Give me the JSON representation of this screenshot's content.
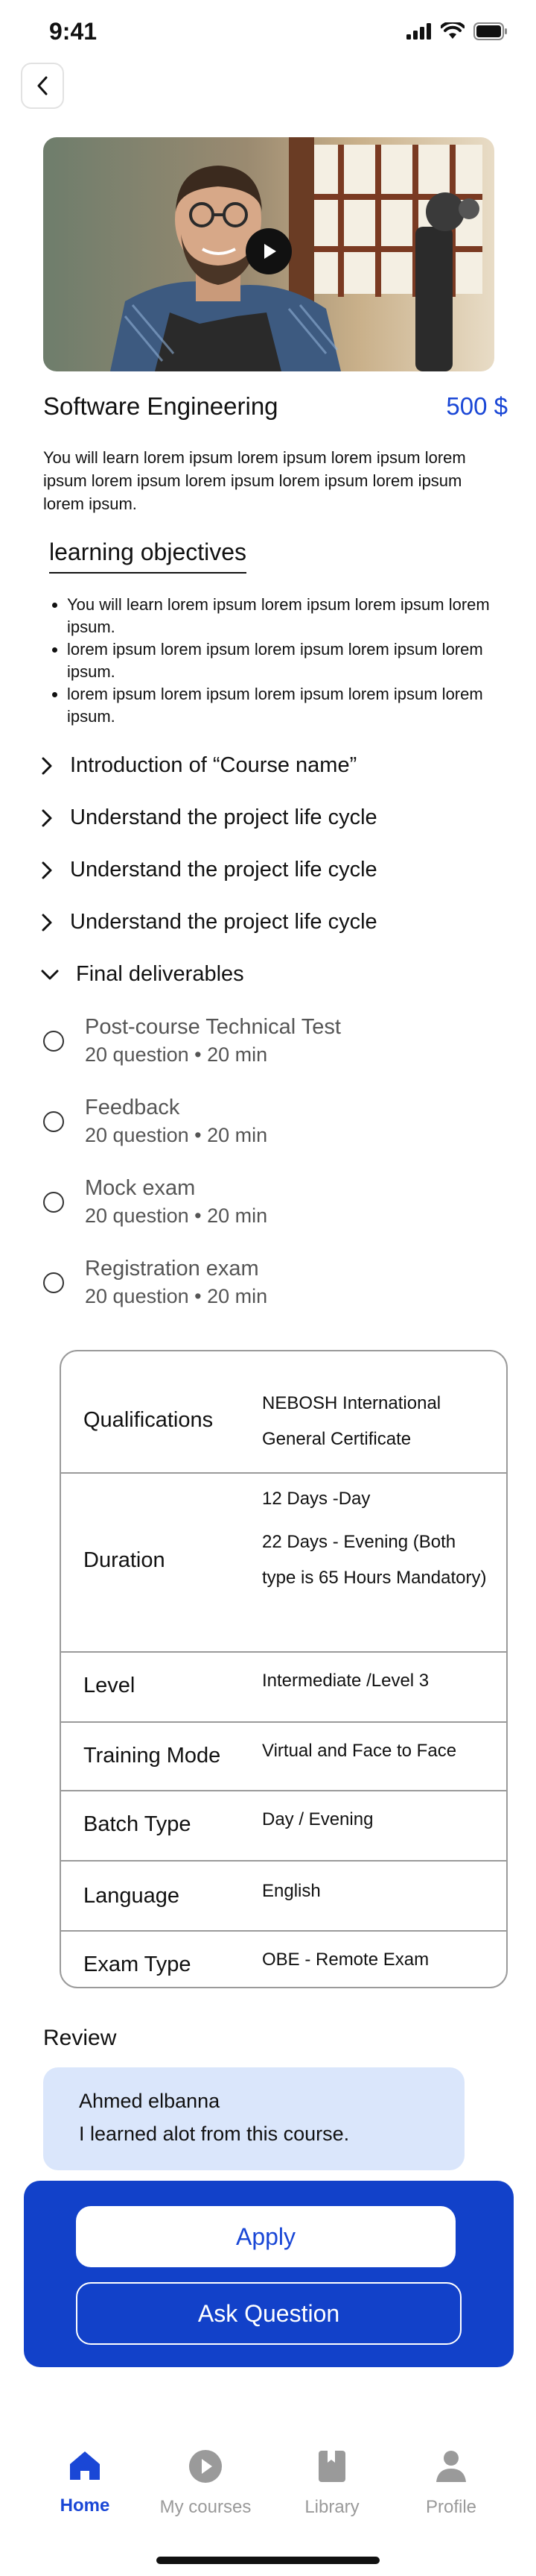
{
  "status": {
    "time": "9:41"
  },
  "course": {
    "title": "Software Engineering",
    "price": "500 $",
    "description": "You will learn lorem ipsum lorem ipsum lorem ipsum lorem ipsum lorem ipsum lorem ipsum lorem ipsum lorem ipsum lorem ipsum."
  },
  "objectives": {
    "title": "learning objectives",
    "items": [
      "You will learn lorem ipsum lorem ipsum lorem ipsum lorem ipsum.",
      "lorem ipsum lorem ipsum lorem ipsum lorem ipsum lorem ipsum.",
      "lorem ipsum lorem ipsum lorem ipsum lorem ipsum lorem ipsum."
    ]
  },
  "modules": [
    "Introduction of “Course name”",
    "Understand the project life cycle",
    "Understand the project life cycle",
    "Understand the project life cycle"
  ],
  "final": {
    "label": "Final deliverables",
    "items": [
      {
        "title": "Post-course Technical Test",
        "meta": "20 question • 20 min"
      },
      {
        "title": "Feedback",
        "meta": "20 question • 20 min"
      },
      {
        "title": "Mock exam",
        "meta": "20 question • 20 min"
      },
      {
        "title": "Registration exam",
        "meta": "20 question • 20 min"
      }
    ]
  },
  "info": {
    "qualifications": {
      "label": "Qualifications",
      "value": "NEBOSH International General Certificate"
    },
    "duration": {
      "label": "Duration",
      "value1": "12 Days -Day",
      "value2": "22 Days - Evening (Both type is 65 Hours Mandatory)"
    },
    "level": {
      "label": "Level",
      "value": "Intermediate /Level 3"
    },
    "training_mode": {
      "label": "Training Mode",
      "value": "Virtual and Face to Face"
    },
    "batch_type": {
      "label": "Batch Type",
      "value": "Day / Evening"
    },
    "language": {
      "label": "Language",
      "value": "English"
    },
    "exam_type": {
      "label": "Exam Type",
      "value": "OBE - Remote Exam"
    }
  },
  "review": {
    "title": "Review",
    "name": "Ahmed elbanna",
    "text": "I learned alot from this course."
  },
  "actions": {
    "apply": "Apply",
    "ask": "Ask Question"
  },
  "nav": {
    "home": "Home",
    "my_courses": "My courses",
    "library": "Library",
    "profile": "Profile"
  },
  "colors": {
    "accent": "#1a47d6",
    "panel": "#1241c9",
    "review_bg": "#dae6fb"
  }
}
